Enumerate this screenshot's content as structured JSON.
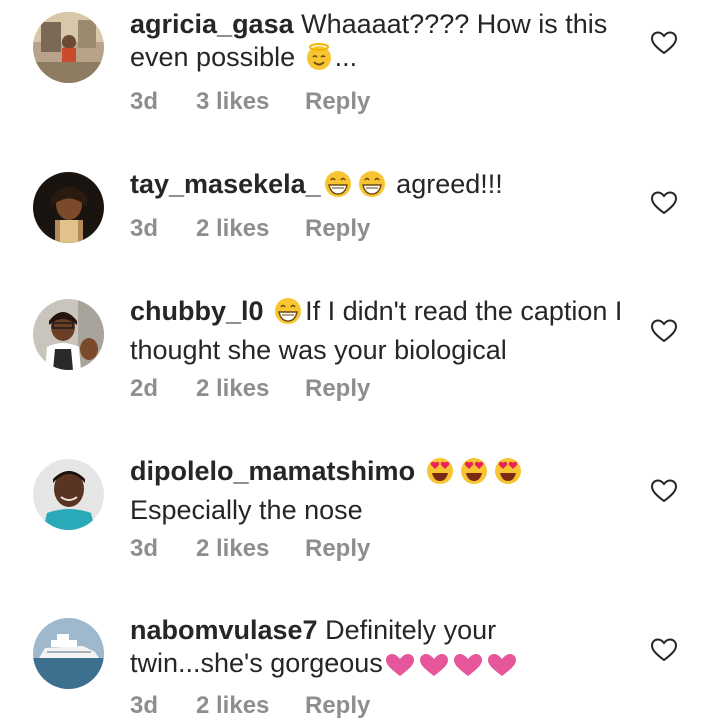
{
  "comments": [
    {
      "username": "agricia_gasa",
      "text": " Whaaaat???? How is this even possible ",
      "trailing": "...",
      "age": "3d",
      "likes": "3 likes",
      "reply": "Reply",
      "emoji": "smiling-face-with-halo"
    },
    {
      "username": "tay_masekela_",
      "text": " agreed!!!",
      "age": "3d",
      "likes": "2 likes",
      "reply": "Reply",
      "emoji": "grinning-face"
    },
    {
      "username": "chubby_l0",
      "text": "If I didn't read the caption I thought she was your biological",
      "age": "2d",
      "likes": "2 likes",
      "reply": "Reply",
      "emoji": "grinning-face"
    },
    {
      "username": "dipolelo_mamatshimo",
      "text": "Especially the nose",
      "age": "3d",
      "likes": "2 likes",
      "reply": "Reply",
      "emoji": "heart-eyes-face"
    },
    {
      "username": "nabomvulase7",
      "text": " Definitely your twin...she's gorgeous",
      "age": "3d",
      "likes": "2 likes",
      "reply": "Reply",
      "emoji": "pink-heart"
    }
  ],
  "colors": {
    "text": "#262626",
    "meta": "#8e8e8e",
    "emoji": "#f7c531",
    "heart": "#e5579a"
  }
}
